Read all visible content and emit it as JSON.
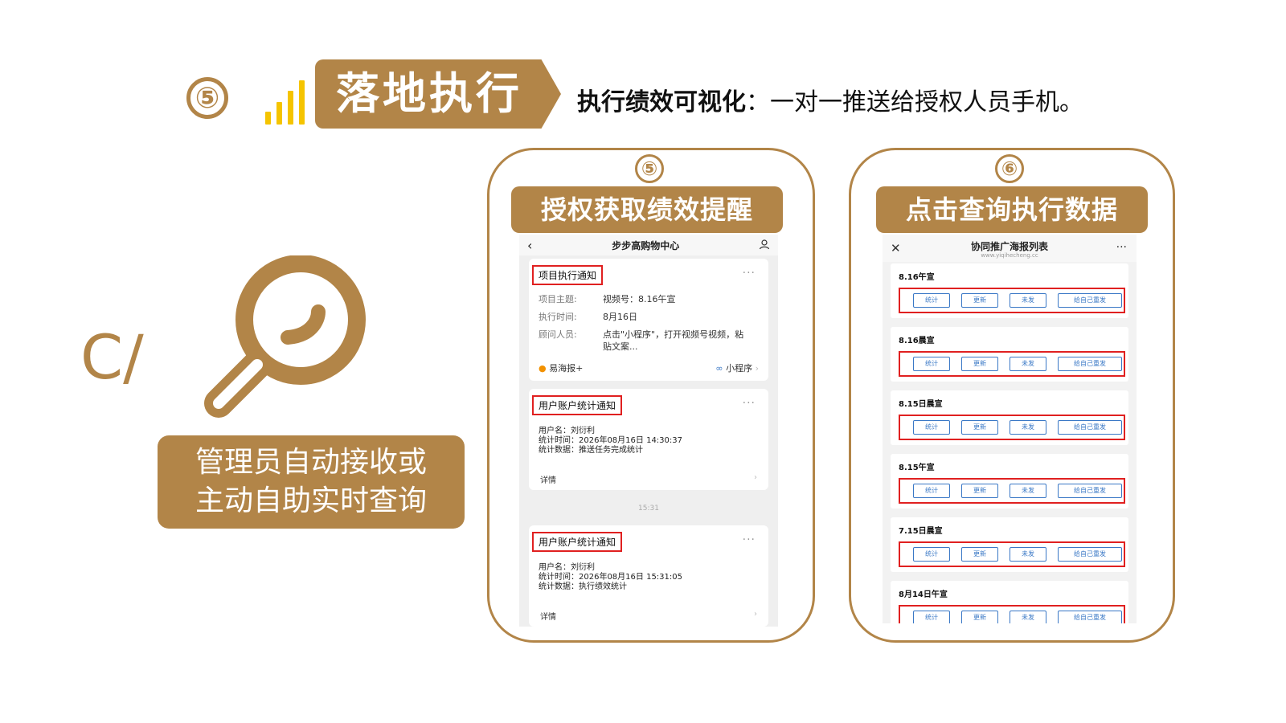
{
  "header": {
    "step_number": "⑤",
    "title": "落地执行",
    "subtitle_bold": "执行绩效可视化",
    "subtitle_rest": "：一对一推送给授权人员手机。"
  },
  "left": {
    "logo_text": "C/",
    "admin_line1": "管理员自动接收或",
    "admin_line2": "主动自助实时查询"
  },
  "phone1": {
    "number": "⑤",
    "banner": "授权获取绩效提醒",
    "nav_title": "步步高购物中心",
    "card1": {
      "title": "项目执行通知",
      "dots": "···",
      "rows": [
        {
          "k": "项目主题:",
          "v": "视频号：8.16午宣"
        },
        {
          "k": "执行时间:",
          "v": "8月16日"
        },
        {
          "k": "顾问人员:",
          "v": "点击\"小程序\"，打开视频号视频，粘贴文案..."
        }
      ],
      "footer_left": "易海报+",
      "footer_right": "小程序"
    },
    "card2": {
      "title": "用户账户统计通知",
      "dots": "···",
      "lines": [
        "用户名：刘衍利",
        "统计时间：2026年08月16日 14:30:37",
        "统计数据：推送任务完成统计"
      ],
      "detail": "详情"
    },
    "timestamp": "15:31",
    "card3": {
      "title": "用户账户统计通知",
      "dots": "···",
      "lines": [
        "用户名：刘衍利",
        "统计时间：2026年08月16日 15:31:05",
        "统计数据：执行绩效统计"
      ],
      "detail": "详情"
    }
  },
  "phone2": {
    "number": "⑥",
    "banner": "点击查询执行数据",
    "nav_title": "协同推广海报列表",
    "nav_sub": "www.yiqihecheng.cc",
    "nav_more": "···",
    "buttons": [
      "统计",
      "更新",
      "未发",
      "给自己重发"
    ],
    "items": [
      "8.16午宣",
      "8.16晨宣",
      "8.15日晨宣",
      "8.15午宣",
      "7.15日晨宣",
      "8月14日午宣"
    ]
  },
  "colors": {
    "accent": "#b28548",
    "highlight": "#e02020",
    "link": "#3a78c6",
    "signal": "#f5c400"
  }
}
